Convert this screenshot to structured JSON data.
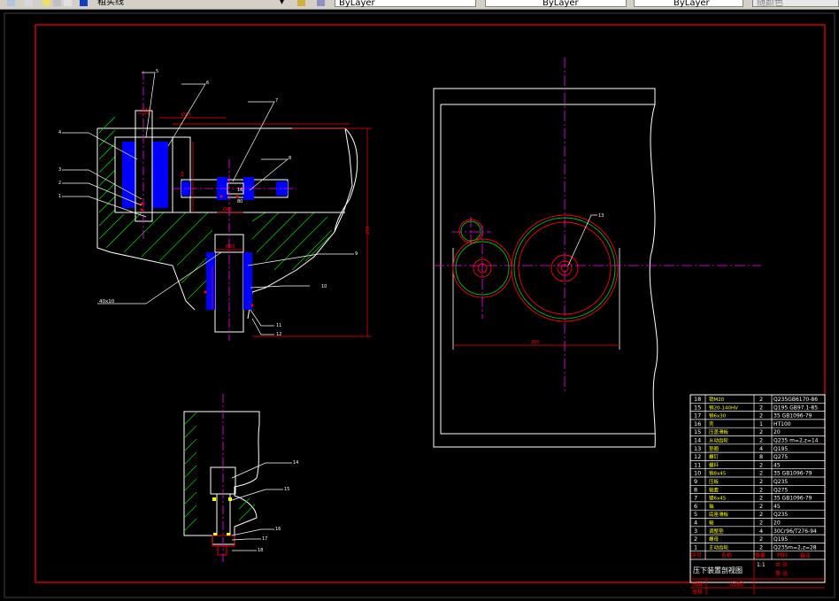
{
  "toolbar": {
    "layer_name": "粗实线",
    "color_control": "ByLayer",
    "linetype_control": "ByLayer",
    "lineweight_control": "ByLayer",
    "plot_style": "随颜色"
  },
  "colors": {
    "background": "#000000",
    "frame": "#ff0000",
    "part": "#ffffff",
    "hatch": "#00c800",
    "fill": "#0000ff",
    "dimension": "#ff0000",
    "centerline": "#ff00ff",
    "leader": "#ffff00",
    "text": "#ffff00",
    "gear": "#ff0000"
  },
  "drawing": {
    "labels": {
      "d1": "40x10"
    }
  },
  "title_block": {
    "title": "压下装置剖视图",
    "subtitle": "(日期)",
    "headers": [
      "序号",
      "名称",
      "数量",
      "材料",
      "备注"
    ],
    "sheet": [
      "共",
      "张",
      "第",
      "张"
    ],
    "scale": "1:1",
    "sign": [
      "制图",
      "审核"
    ],
    "rows": [
      {
        "no": "18",
        "name": "销M20",
        "qty": "2",
        "mat": "Q235GB6170-86"
      },
      {
        "no": "15",
        "name": "销20-140HV",
        "qty": "2",
        "mat": "Q195 GB97.1-85"
      },
      {
        "no": "17",
        "name": "销6x30",
        "qty": "2",
        "mat": "35 GB1096-79"
      },
      {
        "no": "16",
        "name": "壳",
        "qty": "1",
        "mat": "HT100"
      },
      {
        "no": "15",
        "name": "压盖滑板",
        "qty": "2",
        "mat": "20"
      },
      {
        "no": "14",
        "name": "从动齿轮",
        "qty": "2",
        "mat": "Q235 m=2,z=14"
      },
      {
        "no": "13",
        "name": "垫圈",
        "qty": "4",
        "mat": "Q195"
      },
      {
        "no": "12",
        "name": "螺钉",
        "qty": "8",
        "mat": "Q275"
      },
      {
        "no": "11",
        "name": "螺杆",
        "qty": "2",
        "mat": "45"
      },
      {
        "no": "10",
        "name": "销8x45",
        "qty": "2",
        "mat": "35 GB1096-79"
      },
      {
        "no": "9",
        "name": "压板",
        "qty": "2",
        "mat": "Q235"
      },
      {
        "no": "8",
        "name": "轴套",
        "qty": "2",
        "mat": "Q275"
      },
      {
        "no": "7",
        "name": "键6x45",
        "qty": "2",
        "mat": "35 GB1096-79"
      },
      {
        "no": "6",
        "name": "轴",
        "qty": "2",
        "mat": "45"
      },
      {
        "no": "5",
        "name": "底座滑板",
        "qty": "2",
        "mat": "Q235"
      },
      {
        "no": "4",
        "name": "轴",
        "qty": "2",
        "mat": "20"
      },
      {
        "no": "3",
        "name": "调整垫",
        "qty": "4",
        "mat": "30Cr96/T276-94"
      },
      {
        "no": "2",
        "name": "螺母",
        "qty": "2",
        "mat": "Q195"
      },
      {
        "no": "1",
        "name": "主动齿轮",
        "qty": "2",
        "mat": "Q235m=2,z=28"
      }
    ]
  }
}
